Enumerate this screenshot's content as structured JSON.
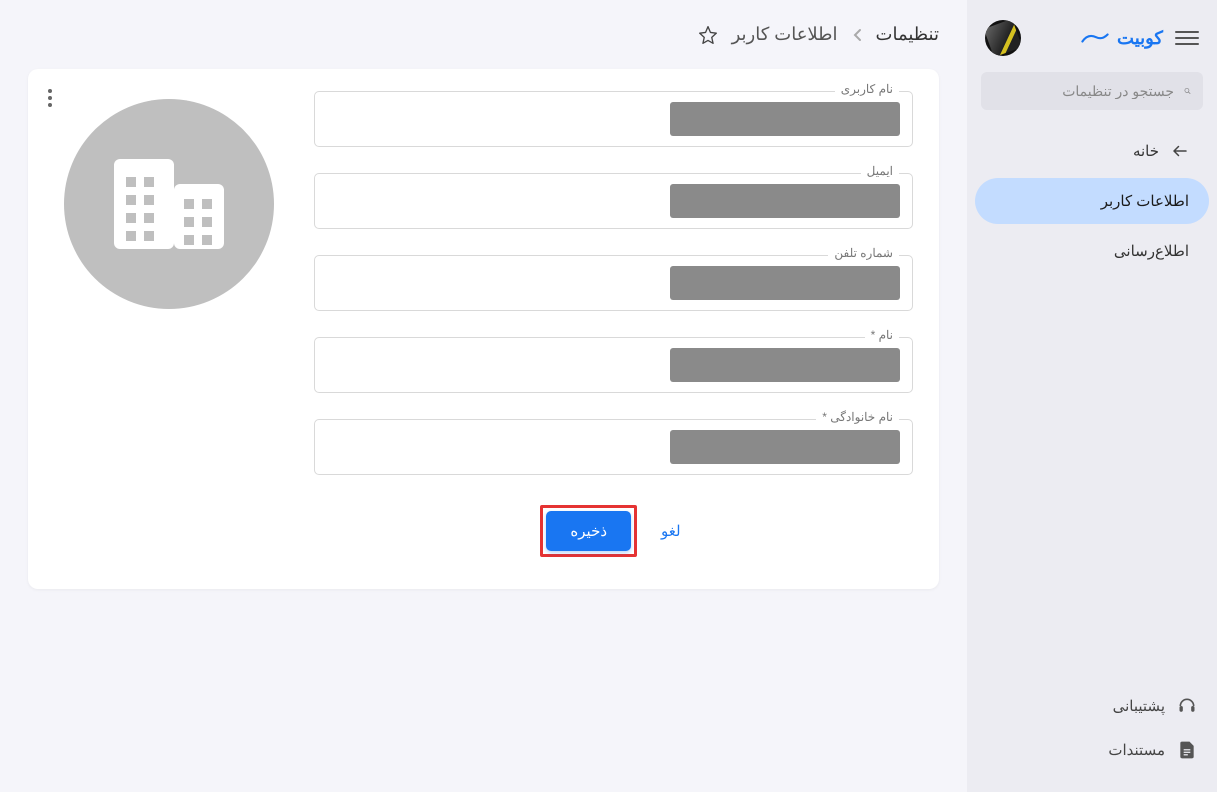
{
  "brand": {
    "name": "کوبیت"
  },
  "sidebar": {
    "search_placeholder": "جستجو در تنظیمات",
    "items": [
      {
        "label": "خانه",
        "icon": "arrow-left",
        "active": false
      },
      {
        "label": "اطلاعات کاربر",
        "icon": "",
        "active": true
      },
      {
        "label": "اطلاع‌رسانی",
        "icon": "",
        "active": false
      }
    ],
    "footer": [
      {
        "label": "پشتیبانی",
        "icon": "headset"
      },
      {
        "label": "مستندات",
        "icon": "file"
      }
    ]
  },
  "breadcrumb": {
    "root": "تنظیمات",
    "current": "اطلاعات کاربر"
  },
  "form": {
    "fields": [
      {
        "label": "نام کاربری",
        "value": ""
      },
      {
        "label": "ایمیل",
        "value": ""
      },
      {
        "label": "شماره تلفن",
        "value": ""
      },
      {
        "label": "نام *",
        "value": ""
      },
      {
        "label": "نام خانوادگی *",
        "value": ""
      }
    ],
    "buttons": {
      "cancel": "لغو",
      "save": "ذخیره"
    }
  }
}
